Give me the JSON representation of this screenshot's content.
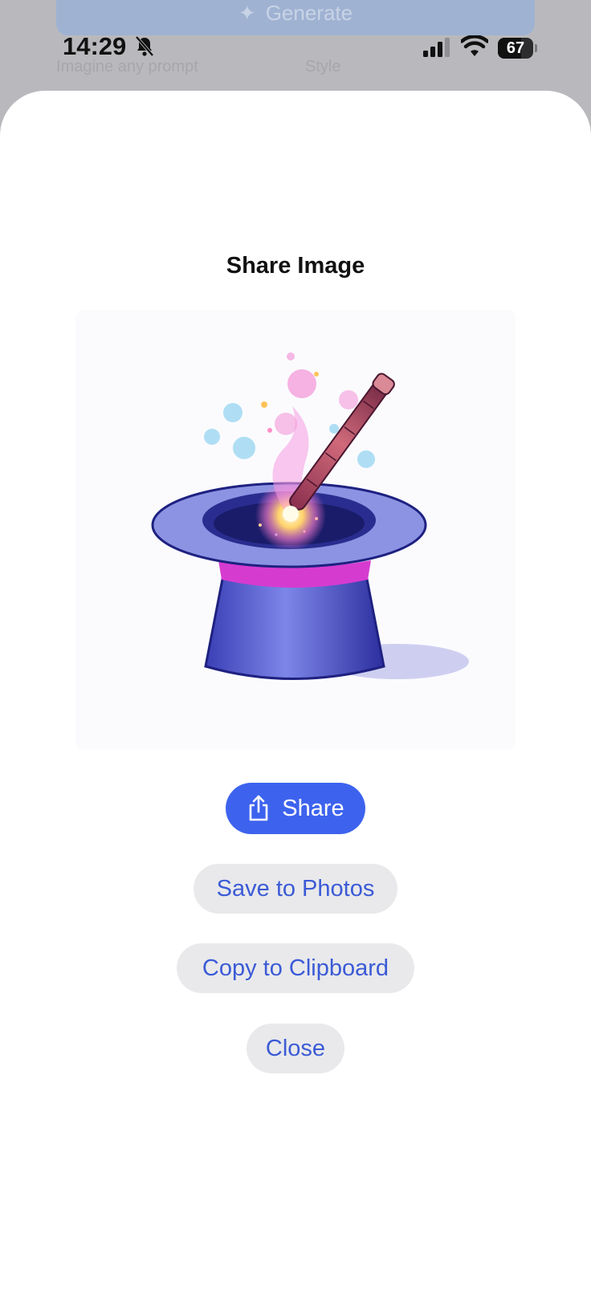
{
  "background_app": {
    "generate_label": "Generate",
    "hint_left": "Imagine any prompt",
    "hint_right": "Style"
  },
  "status_bar": {
    "time": "14:29",
    "battery_level": "67",
    "icons": [
      "bell-slash-icon",
      "cellular-signal-icon",
      "wifi-icon",
      "battery-icon"
    ]
  },
  "sheet": {
    "title": "Share Image",
    "image_description_icon": "magic-top-hat-with-wand",
    "buttons": {
      "share": "Share",
      "save": "Save to Photos",
      "copy": "Copy to Clipboard",
      "close": "Close"
    }
  },
  "colors": {
    "accent": "#3d63ee",
    "secondary_button_bg": "#e9e9eb",
    "secondary_button_text": "#3b5bd6"
  }
}
